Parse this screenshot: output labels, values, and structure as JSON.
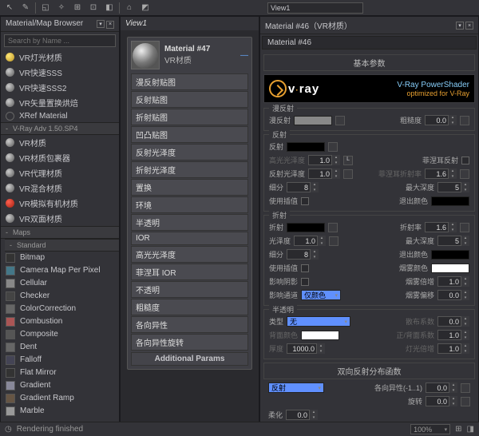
{
  "toolbar": {
    "dropdown": "View1"
  },
  "browser": {
    "title": "Material/Map Browser",
    "search_placeholder": "Search by Name ...",
    "groups": [
      {
        "items": [
          {
            "label": "VR灯光材质",
            "orb": "yellow"
          },
          {
            "label": "VR快速SSS",
            "orb": "gray"
          },
          {
            "label": "VR快速SSS2",
            "orb": "gray"
          },
          {
            "label": "VR矢量置换烘焙",
            "orb": "gray"
          },
          {
            "label": "XRef Material",
            "orb": "empty"
          }
        ]
      },
      {
        "title": "V-Ray Adv 1.50.SP4",
        "items": [
          {
            "label": "VR材质",
            "orb": "gray"
          },
          {
            "label": "VR材质包裹器",
            "orb": "gray"
          },
          {
            "label": "VR代理材质",
            "orb": "gray"
          },
          {
            "label": "VR混合材质",
            "orb": "gray"
          },
          {
            "label": "VR模拟有机材质",
            "orb": "red"
          },
          {
            "label": "VR双面材质",
            "orb": "gray"
          }
        ]
      },
      {
        "title": "Maps"
      },
      {
        "title": "Standard",
        "maps": [
          "Bitmap",
          "Camera Map Per Pixel",
          "Cellular",
          "Checker",
          "ColorCorrection",
          "Combustion",
          "Composite",
          "Dent",
          "Falloff",
          "Flat Mirror",
          "Gradient",
          "Gradient Ramp",
          "Marble"
        ]
      }
    ]
  },
  "view": {
    "title": "View1",
    "mat_title": "Material #47",
    "mat_type": "VR材质",
    "attrs": [
      "漫反射贴图",
      "反射贴图",
      "折射贴图",
      "凹凸贴图",
      "反射光泽度",
      "折射光泽度",
      "置换",
      "环境",
      "半透明",
      "IOR",
      "高光光泽度",
      "菲涅耳 IOR",
      "不透明",
      "粗糙度",
      "各向异性",
      "各向异性旋转"
    ],
    "add_params": "Additional Params"
  },
  "right": {
    "title": "Material #46（VR材质）",
    "sub": "Material #46",
    "rollout": "基本参数",
    "logo": {
      "brand": "v·ray",
      "line1": "V-Ray PowerShader",
      "line2": "optimized for V-Ray"
    },
    "diffuse": {
      "title": "漫反射",
      "lbl": "漫反射",
      "rough_lbl": "粗糙度",
      "rough": "0.0"
    },
    "reflect": {
      "title": "反射",
      "lbl": "反射",
      "hilight_lbl": "高光光泽度",
      "hilight": "1.0",
      "l": "L",
      "fresnel_lbl": "菲涅耳反射",
      "gloss_lbl": "反射光泽度",
      "gloss": "1.0",
      "fior_lbl": "菲涅耳折射率",
      "fior": "1.6",
      "subdiv_lbl": "细分",
      "subdiv": "8",
      "depth_lbl": "最大深度",
      "depth": "5",
      "interp_lbl": "使用插值",
      "exit_lbl": "退出颜色"
    },
    "refract": {
      "title": "折射",
      "lbl": "折射",
      "ior_lbl": "折射率",
      "ior": "1.6",
      "gloss_lbl": "光泽度",
      "gloss": "1.0",
      "depth_lbl": "最大深度",
      "depth": "5",
      "subdiv_lbl": "细分",
      "subdiv": "8",
      "exit_lbl": "退出颜色",
      "interp_lbl": "使用插值",
      "fog_lbl": "烟雾颜色",
      "shadow_lbl": "影响阴影",
      "fogmult_lbl": "烟雾倍增",
      "fogmult": "1.0",
      "channel_lbl": "影响通道",
      "channel": "仅颜色",
      "fogbias_lbl": "烟雾偏移",
      "fogbias": "0.0"
    },
    "trans": {
      "title": "半透明",
      "type_lbl": "类型",
      "type": "无",
      "scatter_lbl": "散布系数",
      "scatter": "0.0",
      "back_lbl": "背面颜色",
      "fb_lbl": "正/背面系数",
      "fb": "1.0",
      "thick_lbl": "厚度",
      "thick": "1000.0",
      "light_lbl": "灯光倍增",
      "light": "1.0"
    },
    "brdf": {
      "title": "双向反射分布函数",
      "mode": "反射",
      "aniso_lbl": "各向异性(-1..1)",
      "aniso": "0.0",
      "rot_lbl": "旋转",
      "rot": "0.0",
      "soft_lbl": "柔化",
      "soft": "0.0"
    }
  },
  "status": {
    "text": "Rendering finished",
    "zoom": "100%"
  }
}
